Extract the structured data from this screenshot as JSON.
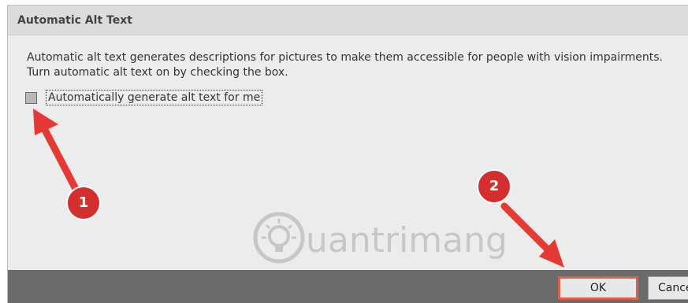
{
  "dialog": {
    "title": "Automatic Alt Text",
    "description_line1": "Automatic alt text generates descriptions for pictures to make them accessible for people with vision impairments.",
    "description_line2": "Turn automatic alt text on by checking the box.",
    "checkbox_label": "Automatically generate alt text for me",
    "checkbox_checked": false
  },
  "footer": {
    "ok_label": "OK",
    "cancel_label": "Cancel"
  },
  "annotations": {
    "badge1": "1",
    "badge2": "2",
    "color": "#e53935"
  },
  "watermark": {
    "text": "uantrimang"
  }
}
